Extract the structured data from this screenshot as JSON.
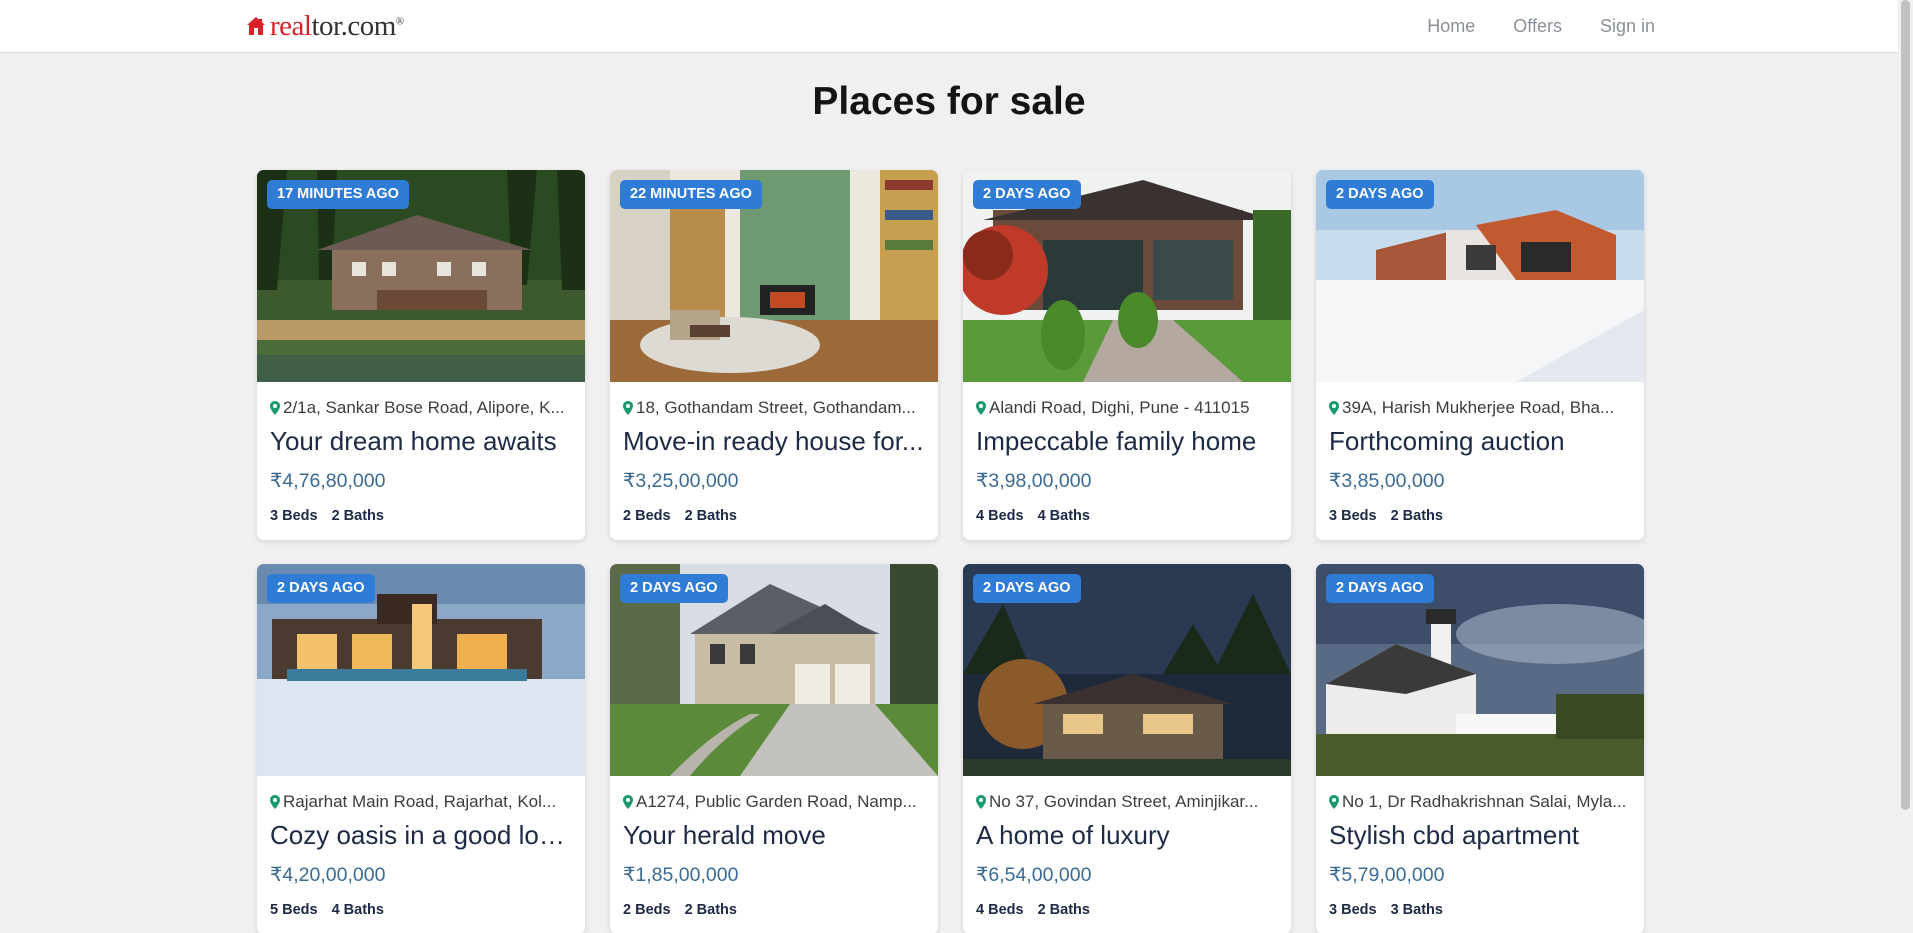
{
  "brand": {
    "logo_text_red": "real",
    "logo_text_dark": "tor.com",
    "logo_mark": "house-icon"
  },
  "nav": {
    "items": [
      "Home",
      "Offers",
      "Sign in"
    ]
  },
  "page": {
    "title": "Places for sale"
  },
  "listings": [
    {
      "posted": "17 MINUTES AGO",
      "address": "2/1a, Sankar Bose Road, Alipore, K...",
      "title": "Your dream home awaits",
      "price": "₹4,76,80,000",
      "beds": "3 Beds",
      "baths": "2 Baths",
      "scene": "forest-house"
    },
    {
      "posted": "22 MINUTES AGO",
      "address": "18, Gothandam Street, Gothandam...",
      "title": "Move-in ready house for...",
      "price": "₹3,25,00,000",
      "beds": "2 Beds",
      "baths": "2 Baths",
      "scene": "living-room"
    },
    {
      "posted": "2 DAYS AGO",
      "address": "Alandi Road, Dighi, Pune - 411015",
      "title": "Impeccable family home",
      "price": "₹3,98,00,000",
      "beds": "4 Beds",
      "baths": "4 Baths",
      "scene": "garden-house"
    },
    {
      "posted": "2 DAYS AGO",
      "address": "39A, Harish Mukherjee Road, Bha...",
      "title": "Forthcoming auction",
      "price": "₹3,85,00,000",
      "beds": "3 Beds",
      "baths": "2 Baths",
      "scene": "snow-modern"
    },
    {
      "posted": "2 DAYS AGO",
      "address": "Rajarhat Main Road, Rajarhat, Kol...",
      "title": "Cozy oasis in a good loc...",
      "price": "₹4,20,00,000",
      "beds": "5 Beds",
      "baths": "4 Baths",
      "scene": "modern-villa"
    },
    {
      "posted": "2 DAYS AGO",
      "address": "A1274, Public Garden Road, Namp...",
      "title": "Your herald move",
      "price": "₹1,85,00,000",
      "beds": "2 Beds",
      "baths": "2 Baths",
      "scene": "suburban-house"
    },
    {
      "posted": "2 DAYS AGO",
      "address": "No 37, Govindan Street, Aminjikar...",
      "title": "A home of luxury",
      "price": "₹6,54,00,000",
      "beds": "4 Beds",
      "baths": "2 Baths",
      "scene": "night-house"
    },
    {
      "posted": "2 DAYS AGO",
      "address": "No 1, Dr Radhakrishnan Salai, Myla...",
      "title": "Stylish cbd apartment",
      "price": "₹5,79,00,000",
      "beds": "3 Beds",
      "baths": "3 Baths",
      "scene": "lighthouse"
    }
  ],
  "colors": {
    "badge": "#2f7cd6",
    "price": "#3a6b94",
    "pin": "#1a9a6c",
    "brand_red": "#d92228"
  }
}
